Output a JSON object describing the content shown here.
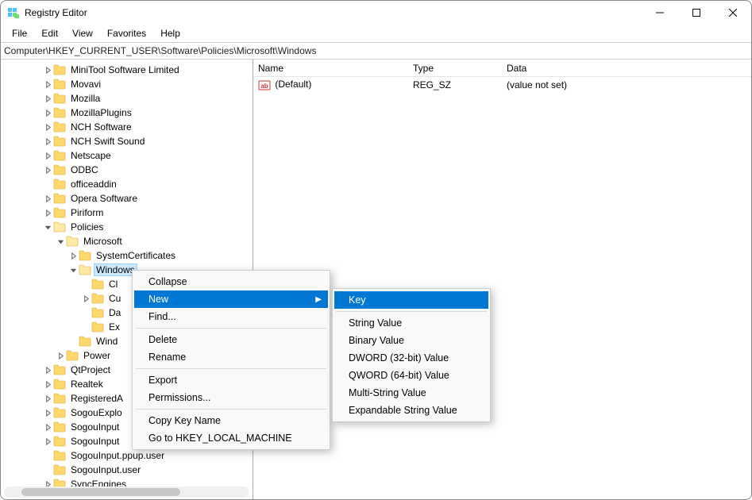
{
  "window": {
    "title": "Registry Editor"
  },
  "menus": {
    "file": "File",
    "edit": "Edit",
    "view": "View",
    "favorites": "Favorites",
    "help": "Help"
  },
  "address": "Computer\\HKEY_CURRENT_USER\\Software\\Policies\\Microsoft\\Windows",
  "tree": {
    "items": [
      {
        "indent": 3,
        "twisty": "right",
        "label": "MiniTool Software Limited"
      },
      {
        "indent": 3,
        "twisty": "right",
        "label": "Movavi"
      },
      {
        "indent": 3,
        "twisty": "right",
        "label": "Mozilla"
      },
      {
        "indent": 3,
        "twisty": "right",
        "label": "MozillaPlugins"
      },
      {
        "indent": 3,
        "twisty": "right",
        "label": "NCH Software"
      },
      {
        "indent": 3,
        "twisty": "right",
        "label": "NCH Swift Sound"
      },
      {
        "indent": 3,
        "twisty": "right",
        "label": "Netscape"
      },
      {
        "indent": 3,
        "twisty": "right",
        "label": "ODBC"
      },
      {
        "indent": 3,
        "twisty": "",
        "label": "officeaddin"
      },
      {
        "indent": 3,
        "twisty": "right",
        "label": "Opera Software"
      },
      {
        "indent": 3,
        "twisty": "right",
        "label": "Piriform"
      },
      {
        "indent": 3,
        "twisty": "down",
        "label": "Policies"
      },
      {
        "indent": 4,
        "twisty": "down",
        "label": "Microsoft"
      },
      {
        "indent": 5,
        "twisty": "right",
        "label": "SystemCertificates"
      },
      {
        "indent": 5,
        "twisty": "down",
        "label": "Windows",
        "selected": true
      },
      {
        "indent": 6,
        "twisty": "",
        "label": "Cl"
      },
      {
        "indent": 6,
        "twisty": "right",
        "label": "Cu"
      },
      {
        "indent": 6,
        "twisty": "",
        "label": "Da"
      },
      {
        "indent": 6,
        "twisty": "",
        "label": "Ex"
      },
      {
        "indent": 5,
        "twisty": "",
        "label": "Wind"
      },
      {
        "indent": 4,
        "twisty": "right",
        "label": "Power"
      },
      {
        "indent": 3,
        "twisty": "right",
        "label": "QtProject"
      },
      {
        "indent": 3,
        "twisty": "right",
        "label": "Realtek"
      },
      {
        "indent": 3,
        "twisty": "right",
        "label": "RegisteredA"
      },
      {
        "indent": 3,
        "twisty": "right",
        "label": "SogouExplo"
      },
      {
        "indent": 3,
        "twisty": "right",
        "label": "SogouInput"
      },
      {
        "indent": 3,
        "twisty": "right",
        "label": "SogouInput"
      },
      {
        "indent": 3,
        "twisty": "",
        "label": "SogouInput.ppup.user"
      },
      {
        "indent": 3,
        "twisty": "",
        "label": "SogouInput.user"
      },
      {
        "indent": 3,
        "twisty": "right",
        "label": "SyncEngines"
      }
    ]
  },
  "list": {
    "headers": {
      "name": "Name",
      "type": "Type",
      "data": "Data"
    },
    "rows": [
      {
        "name": "(Default)",
        "type": "REG_SZ",
        "data": "(value not set)"
      }
    ]
  },
  "context_menu": {
    "collapse": "Collapse",
    "new": "New",
    "find": "Find...",
    "delete": "Delete",
    "rename": "Rename",
    "export": "Export",
    "permissions": "Permissions...",
    "copy_key": "Copy Key Name",
    "goto": "Go to HKEY_LOCAL_MACHINE"
  },
  "submenu_new": {
    "key": "Key",
    "string": "String Value",
    "binary": "Binary Value",
    "dword": "DWORD (32-bit) Value",
    "qword": "QWORD (64-bit) Value",
    "multi": "Multi-String Value",
    "expand": "Expandable String Value"
  }
}
